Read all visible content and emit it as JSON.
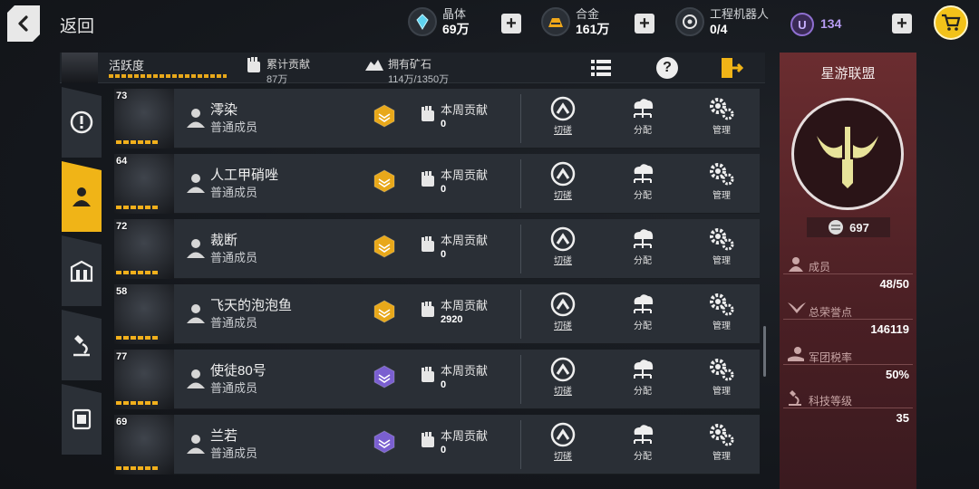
{
  "top": {
    "back_label": "返回",
    "crystal": {
      "label": "晶体",
      "value": "69万"
    },
    "alloy": {
      "label": "合金",
      "value": "161万"
    },
    "robot": {
      "label": "工程机器人",
      "value": "0/4"
    },
    "u_badge": "U",
    "u_value": "134",
    "plus": "+"
  },
  "header": {
    "activity_label": "活跃度",
    "contribution_label": "累计贡献",
    "contribution_value": "87万",
    "ore_label": "拥有矿石",
    "ore_value": "114万/1350万",
    "help": "?"
  },
  "members": [
    {
      "level": "73",
      "name": "澪染",
      "rank": "普通成员",
      "medal": "gold",
      "weekly_label": "本周贡献",
      "weekly_value": "0"
    },
    {
      "level": "64",
      "name": "人工甲硝唑",
      "rank": "普通成员",
      "medal": "gold",
      "weekly_label": "本周贡献",
      "weekly_value": "0"
    },
    {
      "level": "72",
      "name": "裁断",
      "rank": "普通成员",
      "medal": "gold",
      "weekly_label": "本周贡献",
      "weekly_value": "0"
    },
    {
      "level": "58",
      "name": "飞天的泡泡鱼",
      "rank": "普通成员",
      "medal": "gold",
      "weekly_label": "本周贡献",
      "weekly_value": "2920"
    },
    {
      "level": "77",
      "name": "使徒80号",
      "rank": "普通成员",
      "medal": "purple",
      "weekly_label": "本周贡献",
      "weekly_value": "0"
    },
    {
      "level": "69",
      "name": "兰若",
      "rank": "普通成员",
      "medal": "purple",
      "weekly_label": "本周贡献",
      "weekly_value": "0"
    }
  ],
  "actions": {
    "duel": "切磋",
    "assign": "分配",
    "manage": "管理"
  },
  "alliance": {
    "name": "星游联盟",
    "score": "697",
    "members_label": "成员",
    "members_value": "48/50",
    "honor_label": "总荣誉点",
    "honor_value": "146119",
    "tax_label": "军团税率",
    "tax_value": "50%",
    "tech_label": "科技等级",
    "tech_value": "35"
  },
  "colors": {
    "accent": "#f0b417",
    "panel": "#6b2d30",
    "row_bg": "#2a2f36",
    "gold_medal": "#e8a81a",
    "purple_medal": "#7a5fd0"
  }
}
